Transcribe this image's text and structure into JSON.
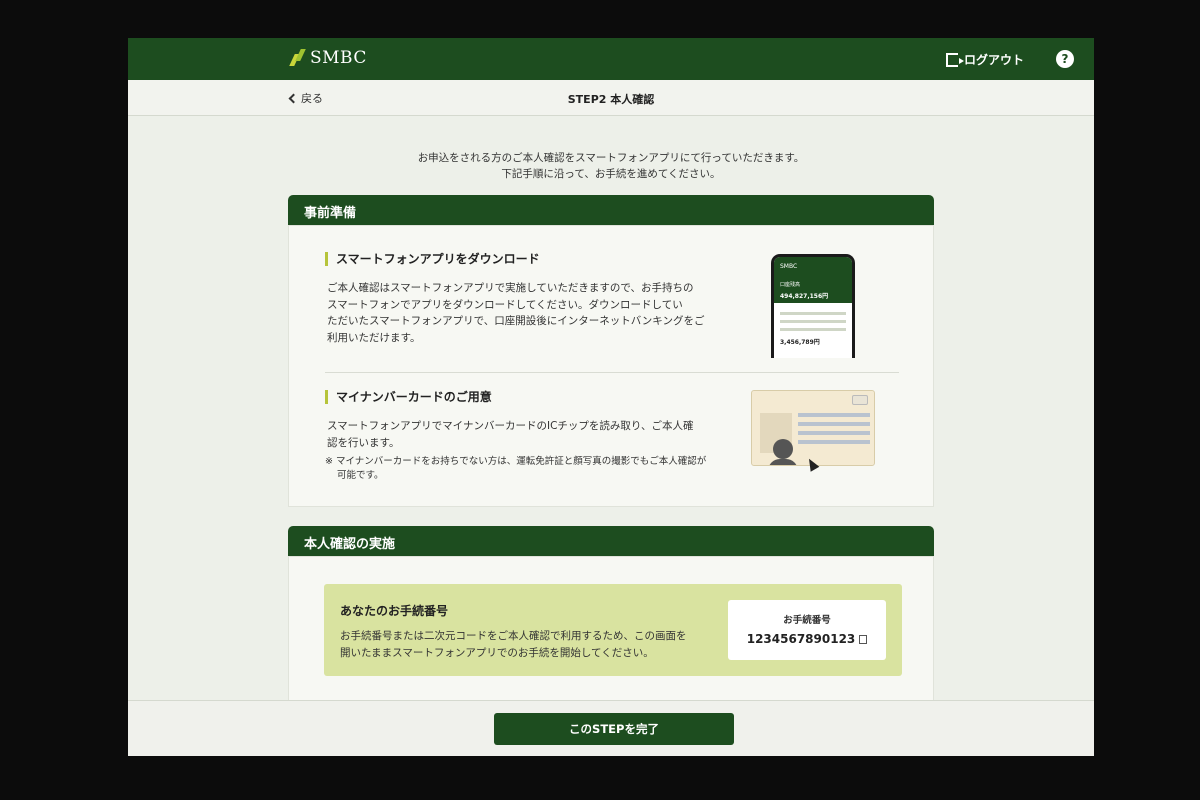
{
  "header": {
    "logo_text": "SMBC",
    "logout_label": "ログアウト",
    "help_label": "?"
  },
  "subnav": {
    "back_label": "戻る",
    "step_title": "STEP2 本人確認"
  },
  "intro": {
    "line1": "お申込をされる方のご本人確認をスマートフォンアプリにて行っていただきます。",
    "line2": "下記手順に沿って、お手続を進めてください。"
  },
  "preparation": {
    "title": "事前準備",
    "download": {
      "heading": "スマートフォンアプリをダウンロード",
      "lines": [
        "ご本人確認はスマートフォンアプリで実施していただきますので、お手持ちの",
        "スマートフォンでアプリをダウンロードしてください。ダウンロードしてい",
        "ただいたスマートフォンアプリで、口座開設後にインターネットバンキングをご",
        "利用いただけます。"
      ],
      "phone": {
        "logo": "SMBC",
        "account_label": "口座残高",
        "balance": "494,827,156円",
        "balance2": "3,456,789円"
      }
    },
    "mynumber": {
      "heading": "マイナンバーカードのご用意",
      "lines": [
        "スマートフォンアプリでマイナンバーカードのICチップを読み取り、ご本人確",
        "認を行います。"
      ],
      "note_line1": "※ マイナンバーカードをお持ちでない方は、運転免許証と顔写真の撮影でもご本人確認が",
      "note_line2": "可能です。"
    }
  },
  "verification": {
    "title": "本人確認の実施",
    "procedure": {
      "heading": "あなたのお手続番号",
      "text_line1": "お手続番号または二次元コードをご本人確認で利用するため、この画面を",
      "text_line2": "開いたままスマートフォンアプリでのお手続を開始してください。",
      "number_label": "お手続番号",
      "number": "1234567890123"
    }
  },
  "footer": {
    "complete_label": "このSTEPを完了"
  },
  "colors": {
    "brand_green": "#1d4d1f",
    "accent_lime": "#c9d63a",
    "procedure_bg": "#d9e3a0"
  }
}
